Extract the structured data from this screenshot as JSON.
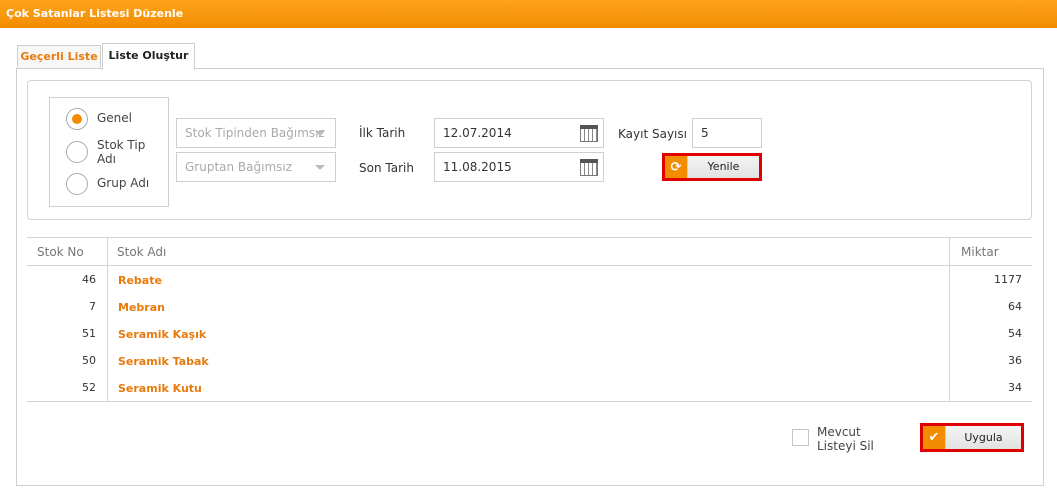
{
  "window": {
    "title": "Çok Satanlar Listesi Düzenle"
  },
  "tabs": [
    {
      "label": "Geçerli Liste",
      "active": false
    },
    {
      "label": "Liste Oluştur",
      "active": true
    }
  ],
  "filters": {
    "radio_options": [
      {
        "label": "Genel",
        "checked": true
      },
      {
        "label": "Stok Tip Adı",
        "checked": false
      },
      {
        "label": "Grup Adı",
        "checked": false
      }
    ],
    "stock_type_select": {
      "value": "Stok Tipinden Bağımsız"
    },
    "group_select": {
      "value": "Gruptan Bağımsız"
    },
    "start_date": {
      "label": "İlk Tarih",
      "value": "12.07.2014"
    },
    "end_date": {
      "label": "Son Tarih",
      "value": "11.08.2015"
    },
    "record_count": {
      "label": "Kayıt Sayısı",
      "value": "5"
    },
    "refresh_button": {
      "label": "Yenile",
      "icon": "refresh-icon"
    }
  },
  "table": {
    "columns": [
      "Stok No",
      "Stok Adı",
      "Miktar"
    ],
    "rows": [
      {
        "no": "46",
        "name": "Rebate",
        "qty": "1177"
      },
      {
        "no": "7",
        "name": "Mebran",
        "qty": "64"
      },
      {
        "no": "51",
        "name": "Seramik Kaşık",
        "qty": "54"
      },
      {
        "no": "50",
        "name": "Seramik Tabak",
        "qty": "36"
      },
      {
        "no": "52",
        "name": "Seramik Kutu",
        "qty": "34"
      }
    ]
  },
  "footer": {
    "clear_list_label": "Mevcut Listeyi Sil",
    "apply_button": {
      "label": "Uygula",
      "icon": "check-icon"
    }
  },
  "colors": {
    "accent": "#f28c00",
    "link": "#e87a0c",
    "highlight_border": "#e00000"
  }
}
